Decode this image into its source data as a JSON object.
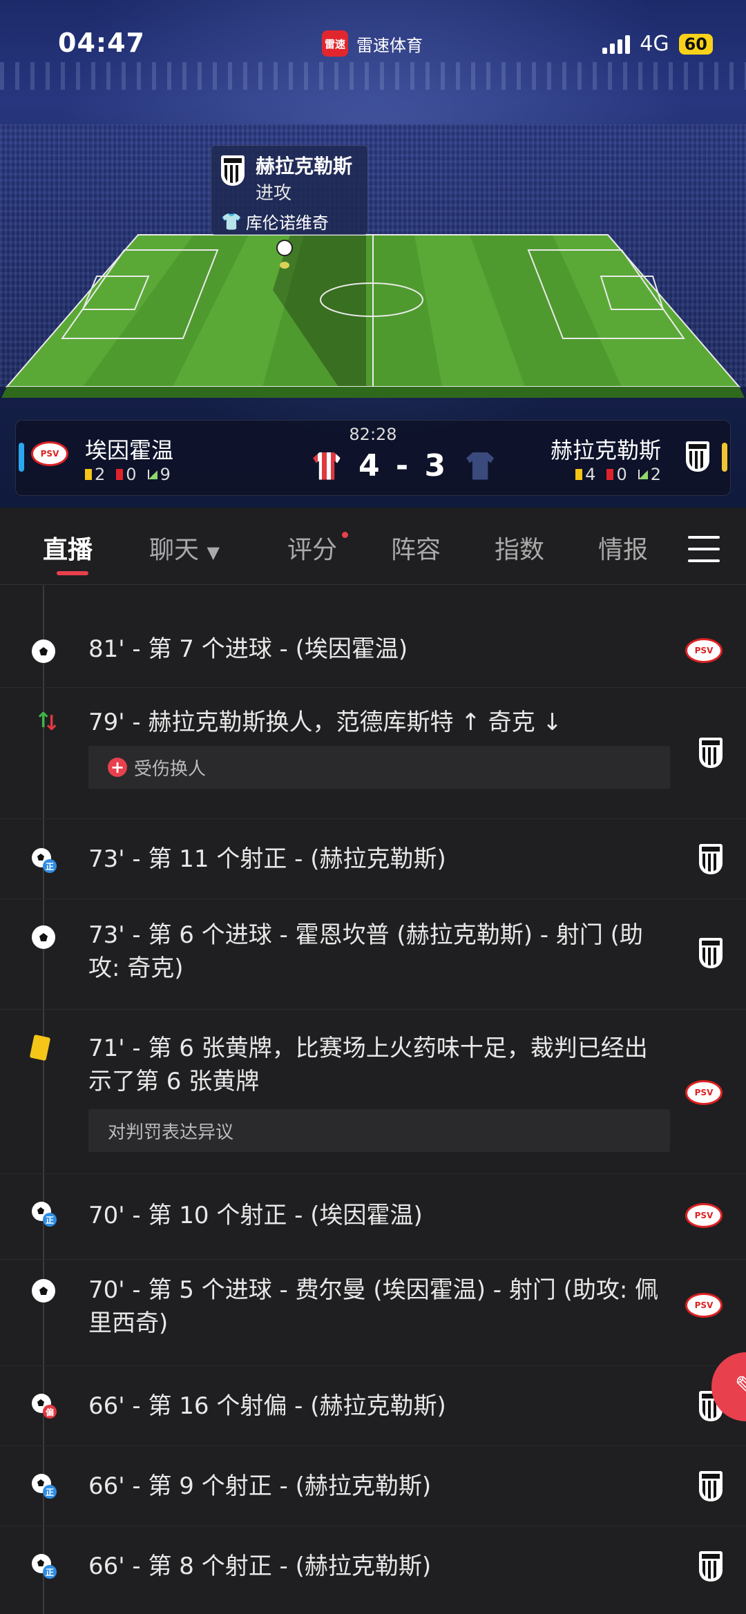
{
  "status": {
    "time": "04:47",
    "network": "4G",
    "battery": "60"
  },
  "app": {
    "logo_text": "雷速",
    "name": "雷速体育"
  },
  "live_event": {
    "team": "赫拉克勒斯",
    "action": "进攻",
    "player": "库伦诺维奇"
  },
  "match": {
    "clock": "82:28",
    "score": "4 - 3",
    "home": {
      "name": "埃因霍温",
      "badge": "PSV",
      "yellow": "2",
      "red": "0",
      "corners": "9"
    },
    "away": {
      "name": "赫拉克勒斯",
      "yellow": "4",
      "red": "0",
      "corners": "2"
    }
  },
  "tabs": [
    "直播",
    "聊天",
    "评分",
    "阵容",
    "指数",
    "情报"
  ],
  "events": [
    {
      "icon": "goal",
      "text": "81' - 第 7 个进球 - (埃因霍温)",
      "team": "home"
    },
    {
      "icon": "sub",
      "text": "79' - 赫拉克勒斯换人，范德库斯特 ↑ 奇克 ↓",
      "note": "受伤换人",
      "team": "away"
    },
    {
      "icon": "shot-on",
      "tag": "正",
      "text": "73' - 第 11 个射正 - (赫拉克勒斯)",
      "team": "away"
    },
    {
      "icon": "goal",
      "text": "73' - 第 6 个进球 - 霍恩坎普 (赫拉克勒斯) - 射门 (助攻: 奇克)",
      "team": "away"
    },
    {
      "icon": "yellow",
      "text": "71' - 第 6 张黄牌，比赛场上火药味十足，裁判已经出示了第 6 张黄牌",
      "note": "对判罚表达异议",
      "team": "home"
    },
    {
      "icon": "shot-on",
      "tag": "正",
      "text": "70' - 第 10 个射正 - (埃因霍温)",
      "team": "home"
    },
    {
      "icon": "goal",
      "text": "70' - 第 5 个进球 - 费尔曼 (埃因霍温) - 射门 (助攻: 佩里西奇)",
      "team": "home"
    },
    {
      "icon": "shot-off",
      "tag": "偏",
      "text": "66' - 第 16 个射偏 - (赫拉克勒斯)",
      "team": "away"
    },
    {
      "icon": "shot-on",
      "tag": "正",
      "text": "66' - 第 9 个射正 - (赫拉克勒斯)",
      "team": "away"
    },
    {
      "icon": "shot-on",
      "tag": "正",
      "text": "66' - 第 8 个射正 - (赫拉克勒斯)",
      "team": "away"
    }
  ],
  "colors": {
    "accent": "#e8404d",
    "pitch": "#4f9a2e",
    "home": "#e0383f",
    "away": "#3a4a7d"
  }
}
